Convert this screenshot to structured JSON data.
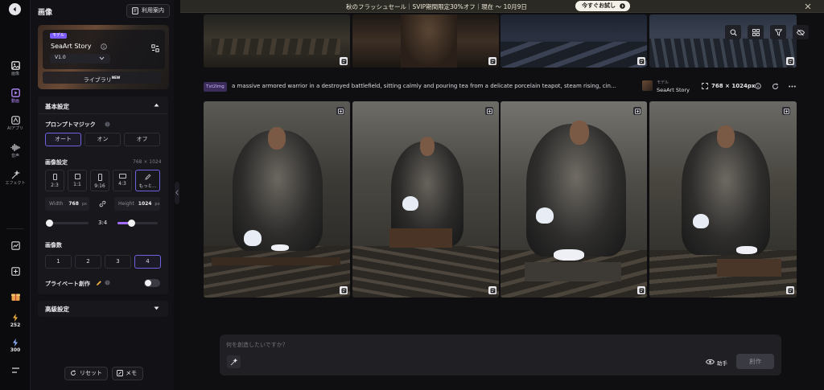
{
  "banner": {
    "text": "秋のフラッシュセール｜SVIP期間限定30%オフ｜現在 ～ 10月9日",
    "cta": "今すぐお試し"
  },
  "rail": {
    "items": [
      {
        "label": "画像",
        "icon": "image-icon"
      },
      {
        "label": "動画",
        "icon": "video-icon"
      },
      {
        "label": "AIアプリ",
        "icon": "ai-app-icon"
      },
      {
        "label": "音声",
        "icon": "audio-icon"
      },
      {
        "label": "エフェクト",
        "icon": "effect-icon"
      }
    ],
    "credits": [
      {
        "value": "252",
        "icon": "lightning-icon"
      },
      {
        "value": "300",
        "icon": "lightning-icon"
      }
    ]
  },
  "panel": {
    "title": "画像",
    "guide_button": "利用案内",
    "model": {
      "tag": "モデル",
      "name": "SeaArt Story",
      "version": "V1.0"
    },
    "library_button": "ライブラリ",
    "library_badge": "NEW",
    "basic_settings": {
      "title": "基本設定",
      "prompt_magic": {
        "label": "プロンプトマジック",
        "options": [
          "オート",
          "オン",
          "オフ"
        ],
        "selected": "オート"
      },
      "image_settings": {
        "label": "画像設定",
        "size_text": "768 × 1024",
        "ratios": [
          "2:3",
          "1:1",
          "9:16",
          "4:3",
          "もっと..."
        ],
        "selected_ratio": "もっと...",
        "width_label": "Width",
        "width_value": "768",
        "width_unit": "px",
        "height_label": "Height",
        "height_value": "1024",
        "height_unit": "px",
        "ratio_display": "3:4"
      },
      "image_count": {
        "label": "画像数",
        "options": [
          "1",
          "2",
          "3",
          "4"
        ],
        "selected": "4"
      },
      "private": {
        "label": "プライベート創作",
        "enabled": false
      }
    },
    "advanced_settings": {
      "title": "高級設定"
    },
    "reset_button": "リセット",
    "memo_button": "メモ"
  },
  "task": {
    "tag": "Txt2Img",
    "prompt": "a massive armored warrior in a destroyed battlefield, sitting calmly and pouring tea from a delicate porcelain teapot, steam rising, cin...",
    "model_tag": "モデル",
    "model_name": "SeaArt Story",
    "size": "768 × 1024px"
  },
  "composer": {
    "placeholder": "何を創造したいですか？",
    "assist_label": "助手",
    "create_button": "創作"
  },
  "colors": {
    "accent": "#6e62e0",
    "panel": "#17171c",
    "background": "#0f0f12"
  }
}
